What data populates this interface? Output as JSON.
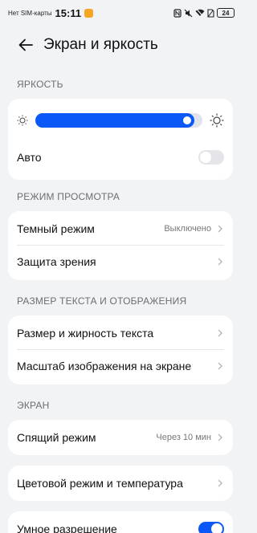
{
  "status_bar": {
    "carrier": "Нет SIM-карты",
    "time": "15:11",
    "battery": "24",
    "icons": [
      "nfc-icon",
      "mute-icon",
      "wifi-icon",
      "no-sim-icon",
      "battery-icon"
    ]
  },
  "header": {
    "title": "Экран и яркость",
    "back_icon": "back-arrow-icon"
  },
  "brightness": {
    "section": "ЯРКОСТЬ",
    "level_percent": 95,
    "auto_label": "Авто",
    "auto_enabled": false
  },
  "view_mode": {
    "section": "РЕЖИМ ПРОСМОТРА",
    "dark_mode_label": "Темный режим",
    "dark_mode_value": "Выключено",
    "eye_protection_label": "Защита зрения"
  },
  "text_display": {
    "section": "РАЗМЕР ТЕКСТА И ОТОБРАЖЕНИЯ",
    "text_size_label": "Размер и жирность текста",
    "display_scale_label": "Масштаб изображения на экране"
  },
  "screen": {
    "section": "ЭКРАН",
    "sleep_label": "Спящий режим",
    "sleep_value": "Через 10 мин",
    "color_mode_label": "Цветовой режим и температура",
    "smart_resolution_label": "Умное разрешение",
    "smart_resolution_enabled": true
  },
  "colors": {
    "accent": "#0a59f7",
    "background": "#f1f3f5",
    "card": "#ffffff"
  }
}
